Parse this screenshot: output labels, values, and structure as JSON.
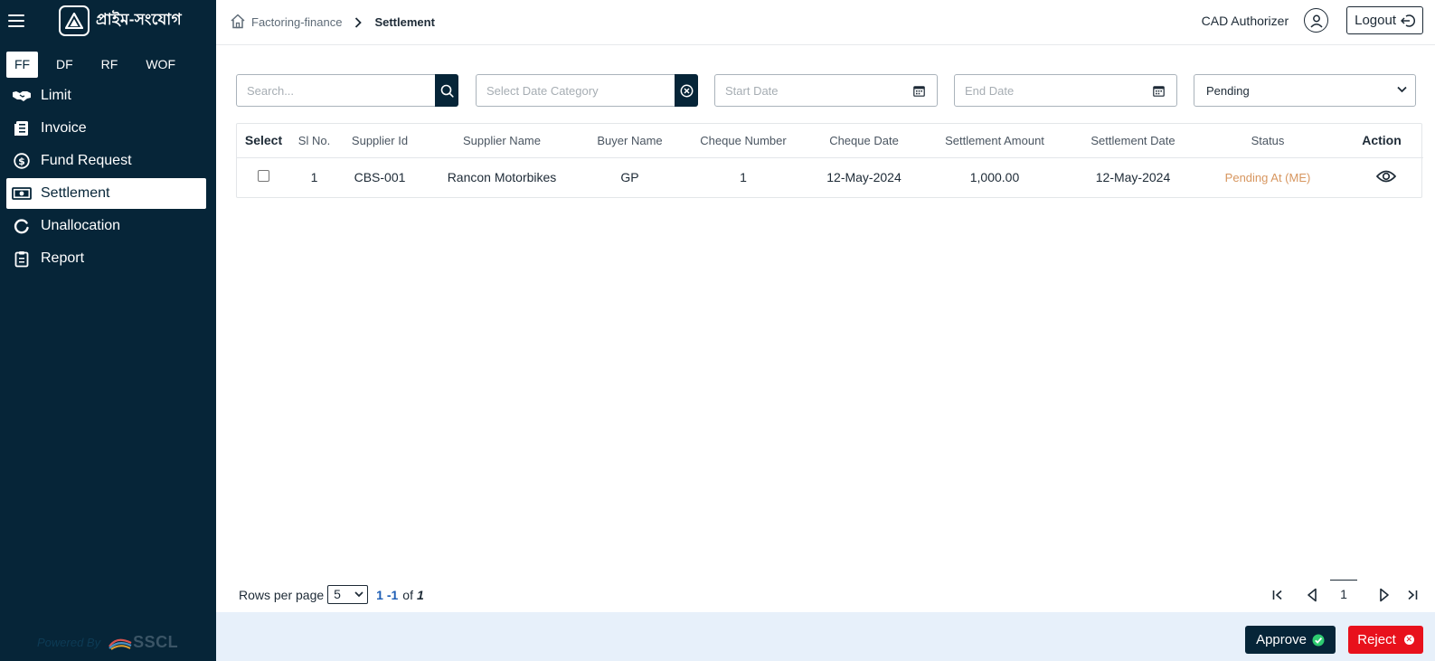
{
  "app": {
    "logo_text": "প্রাইম-সংযোগ",
    "accent_color": "#062538",
    "reject_color": "#e8111c"
  },
  "sidebar": {
    "tabs": [
      {
        "label": "FF",
        "active": true
      },
      {
        "label": "DF",
        "active": false
      },
      {
        "label": "RF",
        "active": false
      },
      {
        "label": "WOF",
        "active": false
      }
    ],
    "items": [
      {
        "label": "Limit",
        "icon": "handshake-icon"
      },
      {
        "label": "Invoice",
        "icon": "document-list-icon"
      },
      {
        "label": "Fund Request",
        "icon": "money-circle-icon"
      },
      {
        "label": "Settlement",
        "icon": "banknote-icon",
        "active": true
      },
      {
        "label": "Unallocation",
        "icon": "circle-arrow-icon"
      },
      {
        "label": "Report",
        "icon": "clipboard-icon"
      }
    ],
    "powered_by": "Powered By",
    "powered_brand": "SSCL"
  },
  "header": {
    "breadcrumb_parent": "Factoring-finance",
    "breadcrumb_current": "Settlement",
    "user_name": "CAD Authorizer",
    "logout_label": "Logout"
  },
  "filters": {
    "search_placeholder": "Search...",
    "date_category_placeholder": "Select Date Category",
    "start_date_placeholder": "Start Date",
    "end_date_placeholder": "End Date",
    "status_selected": "Pending"
  },
  "table": {
    "headers": {
      "select": "Select",
      "sl": "Sl No.",
      "supplier_id": "Supplier Id",
      "supplier_name": "Supplier Name",
      "buyer_name": "Buyer Name",
      "cheque_number": "Cheque Number",
      "cheque_date": "Cheque Date",
      "settlement_amount": "Settlement Amount",
      "settlement_date": "Settlement Date",
      "status": "Status",
      "action": "Action"
    },
    "rows": [
      {
        "sl": "1",
        "supplier_id": "CBS-001",
        "supplier_name": "Rancon Motorbikes",
        "buyer_name": "GP",
        "cheque_number": "1",
        "cheque_date": "12-May-2024",
        "settlement_amount": "1,000.00",
        "settlement_date": "12-May-2024",
        "status": "Pending At (ME)",
        "checked": false
      }
    ]
  },
  "pagination": {
    "rows_per_page_label": "Rows per page",
    "rows_per_page_value": "5",
    "range": "1 -1",
    "of_label": "of",
    "total": "1",
    "current_page": "1"
  },
  "footer": {
    "approve_label": "Approve",
    "reject_label": "Reject"
  }
}
